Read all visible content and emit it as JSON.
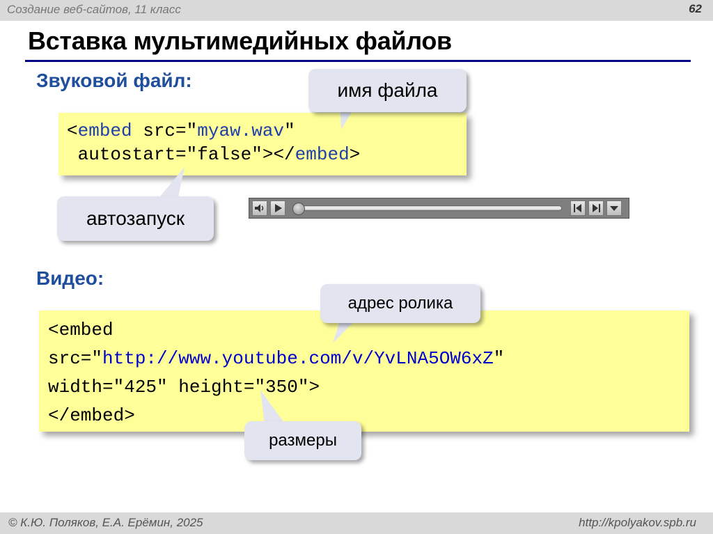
{
  "header": {
    "course": "Создание веб-сайтов, 11 класс",
    "slide_number": "62"
  },
  "title": "Вставка мультимедийных файлов",
  "audio": {
    "heading": "Звуковой файл:",
    "code": {
      "l1_open": "<",
      "l1_tag": "embed",
      "l1_attr": " src=\"",
      "l1_value": "myaw.wav",
      "l1_close": "\"",
      "l2_attr": " autostart=\"false\"></",
      "l2_tag": "embed",
      "l2_end": ">"
    },
    "bubble_filename": "имя файла",
    "bubble_autostart": "автозапуск"
  },
  "video": {
    "heading": "Видео:",
    "code": {
      "l1": "<embed",
      "l2_attr": "src=\"",
      "l2_value": "http://www.youtube.com/v/YvLNA5OW6xZ",
      "l2_close": "\"",
      "l3": "width=\"425\" height=\"350\">",
      "l4": "</embed>"
    },
    "bubble_address": "адрес ролика",
    "bubble_sizes": "размеры"
  },
  "footer": {
    "author": "© К.Ю. Поляков, Е.А. Ерёмин, 2025",
    "site": "http://kpolyakov.spb.ru"
  },
  "colors": {
    "heading": "#1f4e9c",
    "code_bg": "#ffff99",
    "bubble_bg": "#e2e4f0",
    "title_rule": "#000080"
  },
  "icons": [
    "volume-icon",
    "play-icon",
    "rewind-icon",
    "forward-icon",
    "dropdown-icon"
  ]
}
